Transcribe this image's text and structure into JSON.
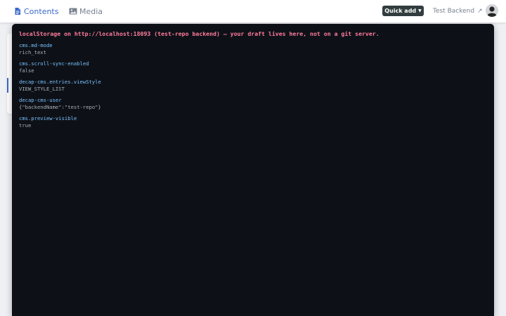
{
  "nav": {
    "contents_label": "Contents",
    "media_label": "Media",
    "contents_icon": "document-icon",
    "media_icon": "image-icon"
  },
  "header": {
    "quick_add_label": "Quick add",
    "backend_label": "Test Backend",
    "backend_icon": "external-link-icon",
    "avatar_icon": "user-avatar-icon"
  },
  "storage": {
    "header": "localStorage on http://localhost:18093 (test-repo backend) — your draft lives here, not on a git server.",
    "entries": [
      {
        "key": "cms.md-mode",
        "value": "rich_text"
      },
      {
        "key": "cms.scroll-sync-enabled",
        "value": "false"
      },
      {
        "key": "decap-cms.entries.viewStyle",
        "value": "VIEW_STYLE_LIST"
      },
      {
        "key": "decap-cms-user",
        "value": "{\"backendName\":\"test-repo\"}"
      },
      {
        "key": "cms.preview-visible",
        "value": "true"
      }
    ]
  },
  "colors": {
    "accent": "#3a69c7",
    "panel_background": "#0d1117",
    "header_text": "#ff7b9c",
    "key_text": "#79c0ff",
    "value_text": "#a7b0ba",
    "quick_add_background": "#313d3e"
  }
}
